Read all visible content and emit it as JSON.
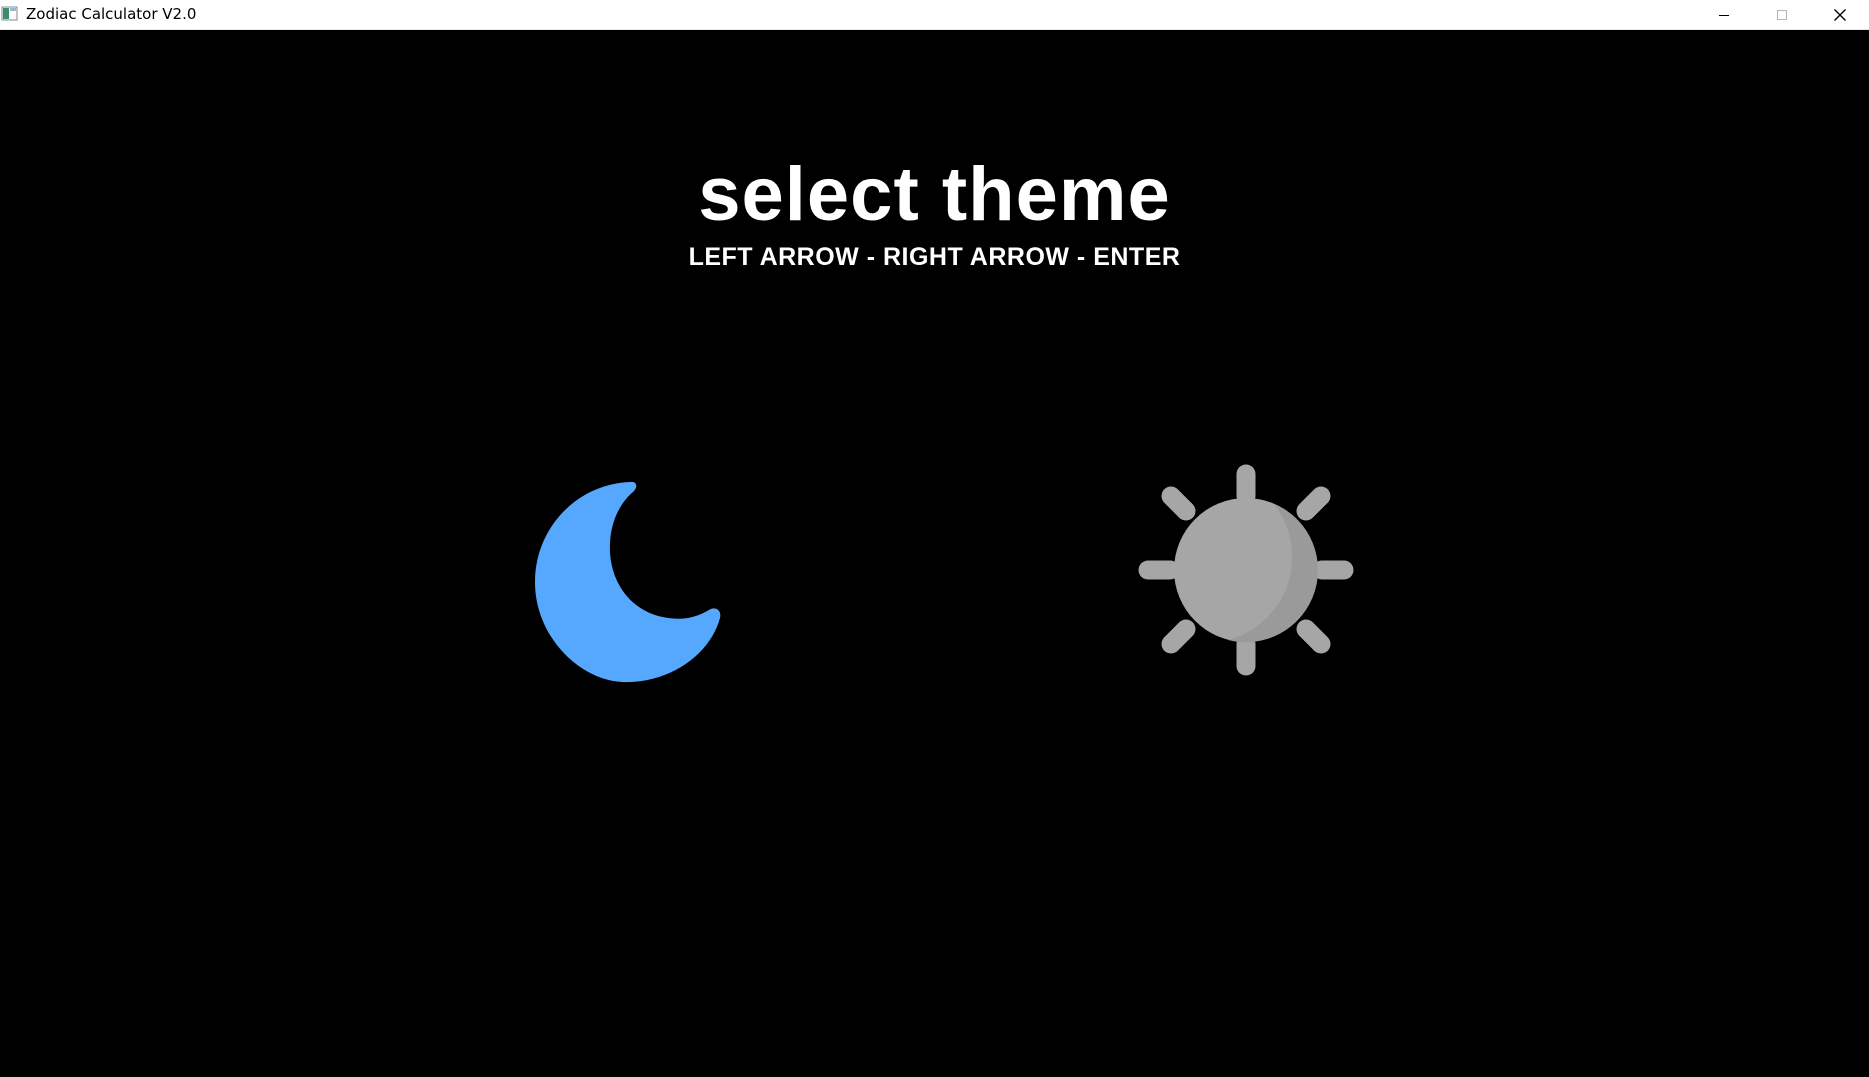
{
  "window": {
    "title": "Zodiac Calculator V2.0",
    "controls": {
      "minimize_icon": "minimize-icon",
      "maximize_icon": "maximize-icon",
      "close_icon": "close-icon"
    }
  },
  "main": {
    "heading": "select theme",
    "instructions": "LEFT ARROW - RIGHT ARROW - ENTER"
  },
  "themes": [
    {
      "icon": "moon-icon",
      "selected": true,
      "color": "#56a8ff"
    },
    {
      "icon": "sun-icon",
      "selected": false,
      "color": "#a6a6a6"
    }
  ],
  "colors": {
    "background": "#000000",
    "text": "#ffffff",
    "selected_accent": "#56a8ff",
    "unselected": "#a6a6a6"
  }
}
